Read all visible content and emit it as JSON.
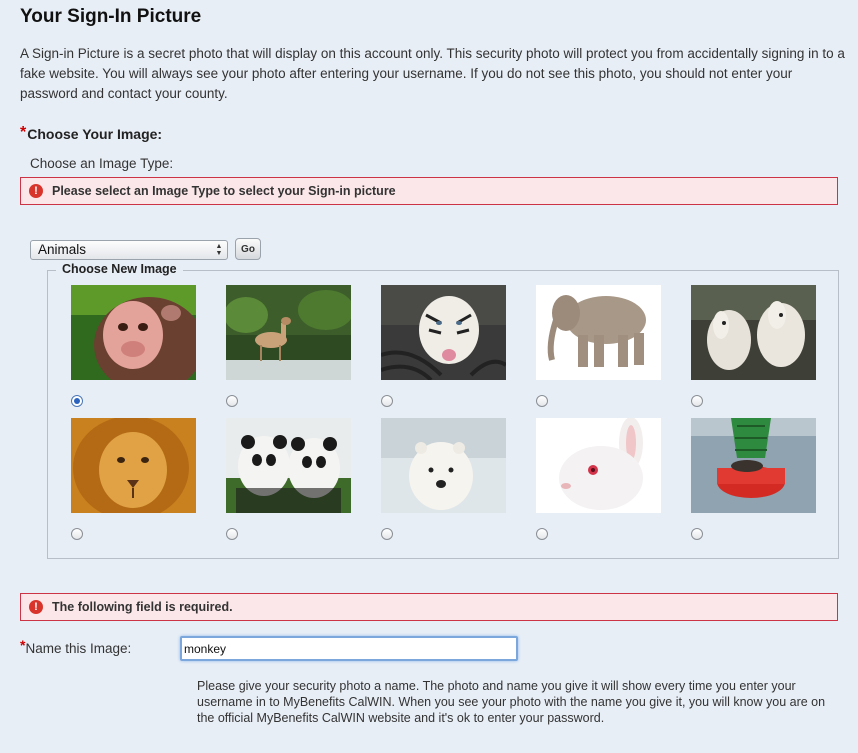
{
  "page": {
    "title": "Your Sign-In Picture",
    "intro": "A Sign-in Picture is a secret photo that will display on this account only. This security photo will protect you from accidentally signing in to a fake website. You will always see your photo after entering your username. If you do not see this photo, you should not enter your password and contact your county."
  },
  "choose_image": {
    "required_marker": "*",
    "heading": "Choose Your Image:",
    "type_label": "Choose an Image Type:",
    "error_icon": "!",
    "type_error": "Please select an Image Type to select your Sign-in picture",
    "image_type_selected": "Animals",
    "go_label": "Go",
    "gallery_legend": "Choose New Image",
    "images": [
      {
        "icon": "monkey-photo",
        "selected": true
      },
      {
        "icon": "deer-photo",
        "selected": false
      },
      {
        "icon": "white-tiger-photo",
        "selected": false
      },
      {
        "icon": "elephant-photo",
        "selected": false
      },
      {
        "icon": "white-horses-photo",
        "selected": false
      },
      {
        "icon": "lion-photo",
        "selected": false
      },
      {
        "icon": "pandas-photo",
        "selected": false
      },
      {
        "icon": "polar-bear-photo",
        "selected": false
      },
      {
        "icon": "white-rabbit-photo",
        "selected": false
      },
      {
        "icon": "sea-lion-buoy-photo",
        "selected": false
      }
    ]
  },
  "name_section": {
    "field_error": "The following field is required.",
    "required_marker": "*",
    "label": "Name this Image:",
    "value": "monkey",
    "help": "Please give your security photo a name. The photo and name you give it will show every time you enter your username in to MyBenefits CalWIN. When you see your photo with the name you give it, you will know you are on the official MyBenefits CalWIN website and it's ok to enter your password."
  },
  "colors": {
    "background": "#e8eef6",
    "error_border": "#cc3344",
    "error_fill": "#fbe7e9",
    "required": "#cc0000"
  }
}
